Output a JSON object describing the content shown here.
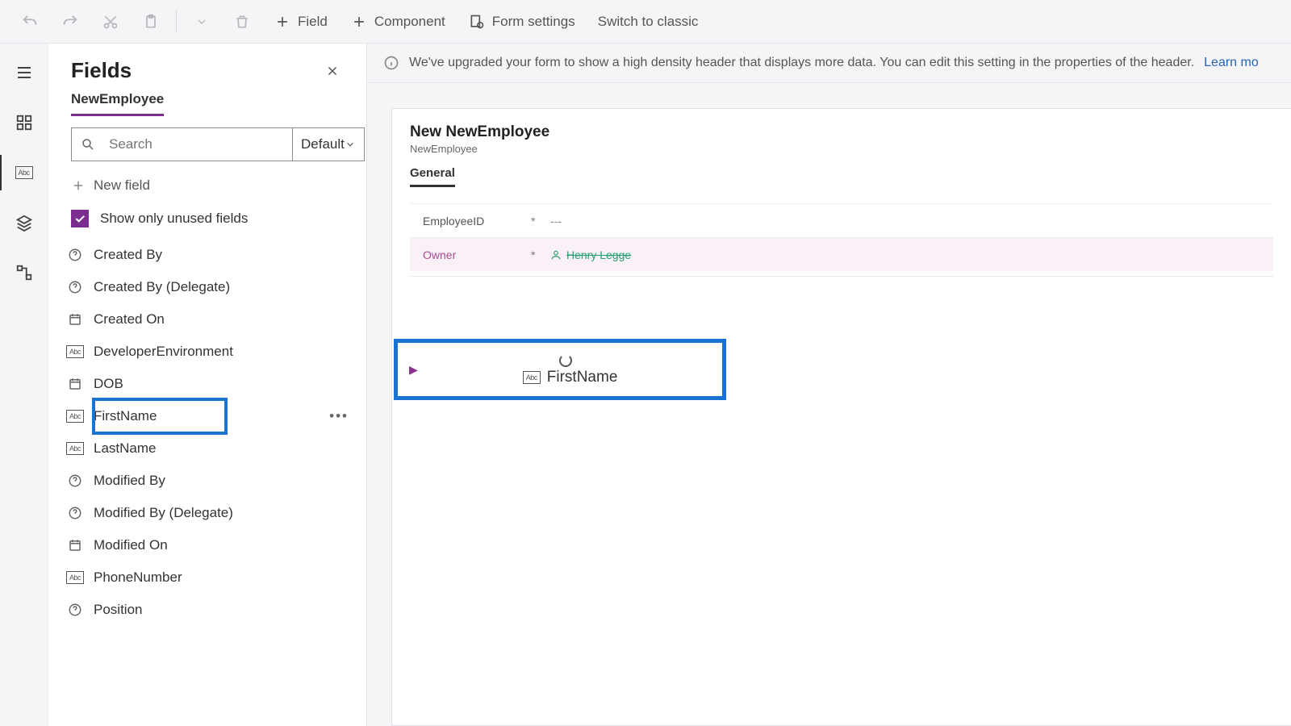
{
  "toolbar": {
    "field": "Field",
    "component": "Component",
    "form_settings": "Form settings",
    "switch_classic": "Switch to classic"
  },
  "fields_panel": {
    "title": "Fields",
    "entity": "NewEmployee",
    "search_placeholder": "Search",
    "dropdown": "Default",
    "new_field": "New field",
    "show_unused": "Show only unused fields",
    "items": [
      {
        "label": "Created By",
        "icon": "help"
      },
      {
        "label": "Created By (Delegate)",
        "icon": "help"
      },
      {
        "label": "Created On",
        "icon": "date"
      },
      {
        "label": "DeveloperEnvironment",
        "icon": "text"
      },
      {
        "label": "DOB",
        "icon": "date"
      },
      {
        "label": "FirstName",
        "icon": "text",
        "selected": true
      },
      {
        "label": "LastName",
        "icon": "text"
      },
      {
        "label": "Modified By",
        "icon": "help"
      },
      {
        "label": "Modified By (Delegate)",
        "icon": "help"
      },
      {
        "label": "Modified On",
        "icon": "date"
      },
      {
        "label": "PhoneNumber",
        "icon": "text"
      },
      {
        "label": "Position",
        "icon": "help"
      }
    ]
  },
  "info_bar": {
    "text": "We've upgraded your form to show a high density header that displays more data. You can edit this setting in the properties of the header.",
    "link": "Learn mo"
  },
  "form": {
    "title": "New NewEmployee",
    "subtitle": "NewEmployee",
    "tab": "General",
    "rows": [
      {
        "label": "EmployeeID",
        "required": "*",
        "value": "---"
      },
      {
        "label": "Owner",
        "required": "*",
        "value": "Henry Legge",
        "selected": true
      }
    ],
    "drop_field": "FirstName"
  }
}
